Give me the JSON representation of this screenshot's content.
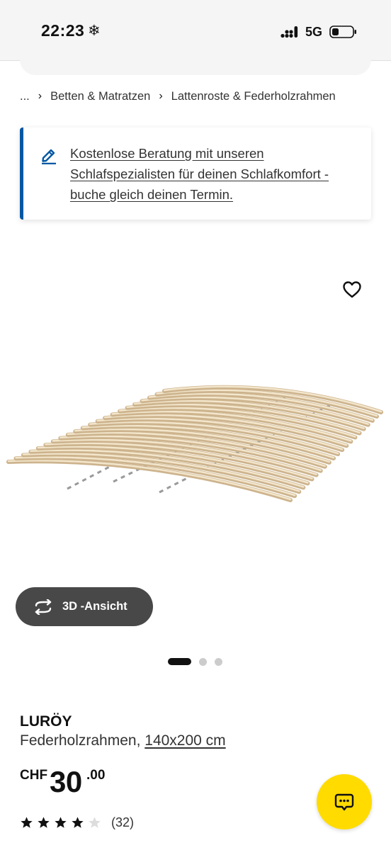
{
  "status_bar": {
    "time": "22:23",
    "weather_glyph": "❄",
    "network": "5G",
    "icons": [
      "signal-icon",
      "battery-icon"
    ]
  },
  "breadcrumb": {
    "ellipsis": "...",
    "items": [
      "Betten & Matratzen",
      "Lattenroste & Federholzrahmen"
    ]
  },
  "promo": {
    "text": "Kostenlose Beratung mit unseren Schlafspezialisten für deinen Schlafkomfort - buche gleich deinen Termin.",
    "icon": "pencil-icon",
    "accent_color": "#0058a3"
  },
  "gallery": {
    "favorite_icon": "heart-icon",
    "view3d_label": "3D -Ansicht",
    "view3d_icon": "rotate-icon",
    "slide_count": 3,
    "active_slide": 1
  },
  "product": {
    "name": "LURÖY",
    "description": "Federholzrahmen, ",
    "size": "140x200 cm",
    "price": {
      "currency": "CHF",
      "integer": "30",
      "decimal": ".00"
    },
    "rating": {
      "stars": 4,
      "max_stars": 5,
      "count": "(32)"
    }
  },
  "chat": {
    "icon": "chat-icon",
    "color": "#ffdb00"
  }
}
